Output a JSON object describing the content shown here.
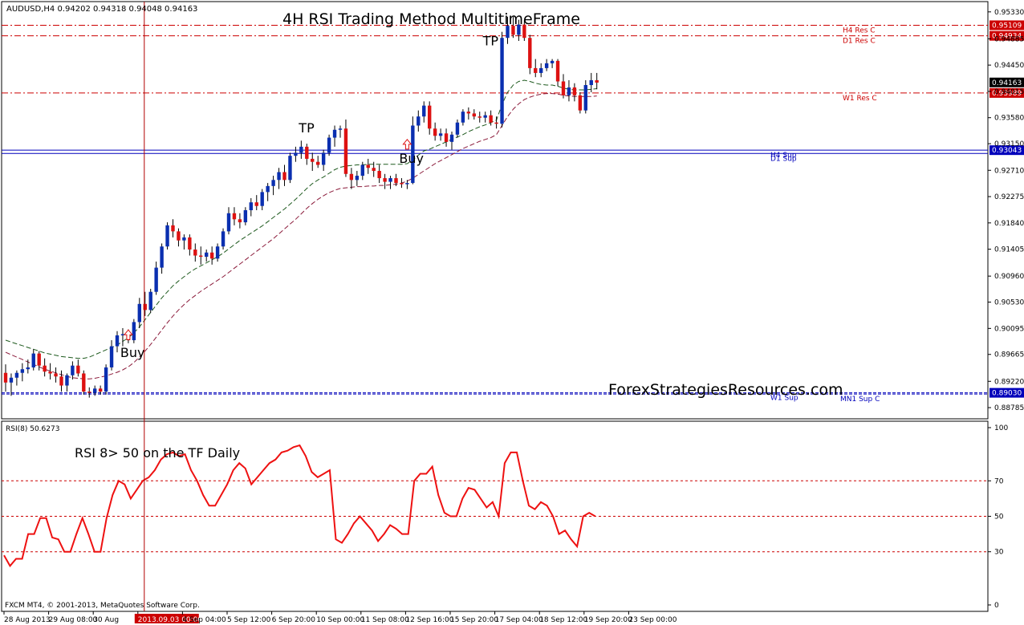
{
  "chart_data": [
    {
      "type": "candlestick",
      "symbol_info": "AUDUSD,H4  0.94202 0.94318 0.94048 0.94163",
      "title": "4H RSI Trading Method MultitimeFrame",
      "watermark": "ForexStrategiesResources.com",
      "ylim": [
        0.886,
        0.955
      ],
      "y_ticks": [
        "0.95330",
        "0.94885",
        "0.94450",
        "0.94015",
        "0.93580",
        "0.93150",
        "0.92710",
        "0.92275",
        "0.91840",
        "0.91405",
        "0.90960",
        "0.90530",
        "0.90095",
        "0.89665",
        "0.89220",
        "0.88785"
      ],
      "y_tick_values": [
        0.9533,
        0.94885,
        0.9445,
        0.94015,
        0.9358,
        0.9315,
        0.9271,
        0.92275,
        0.9184,
        0.91405,
        0.9096,
        0.9053,
        0.90095,
        0.89665,
        0.8922,
        0.88785
      ],
      "x_ticks": [
        "28 Aug 2013",
        "29 Aug 08:00",
        "30 Aug",
        "2013.09.03 00:00",
        "4 Sep 04:00",
        "5 Sep 12:00",
        "6 Sep 20:00",
        "10 Sep 00:00",
        "11 Sep 08:00",
        "12 Sep 16:00",
        "15 Sep 20:00",
        "17 Sep 04:00",
        "18 Sep 12:00",
        "19 Sep 20:00",
        "23 Sep 00:00"
      ],
      "x_tick_bars": [
        0,
        8,
        16,
        24,
        32,
        40,
        48,
        56,
        64,
        72,
        80,
        88,
        96,
        104,
        112
      ],
      "highlight_x_tick": "2013.09.03 00:00",
      "candles_ohlc": [
        [
          0.8936,
          0.895,
          0.8905,
          0.892
        ],
        [
          0.892,
          0.8935,
          0.8898,
          0.8928
        ],
        [
          0.8928,
          0.894,
          0.8915,
          0.8936
        ],
        [
          0.8936,
          0.8952,
          0.8922,
          0.8942
        ],
        [
          0.8942,
          0.8958,
          0.8935,
          0.8945
        ],
        [
          0.8945,
          0.8975,
          0.894,
          0.8968
        ],
        [
          0.8968,
          0.8972,
          0.894,
          0.8948
        ],
        [
          0.8948,
          0.896,
          0.893,
          0.8938
        ],
        [
          0.8938,
          0.8952,
          0.8925,
          0.8935
        ],
        [
          0.8935,
          0.8945,
          0.892,
          0.893
        ],
        [
          0.893,
          0.894,
          0.8905,
          0.8915
        ],
        [
          0.8915,
          0.8935,
          0.8905,
          0.8932
        ],
        [
          0.8932,
          0.8955,
          0.8925,
          0.8948
        ],
        [
          0.8948,
          0.8958,
          0.893,
          0.8935
        ],
        [
          0.8935,
          0.894,
          0.89,
          0.8905
        ],
        [
          0.8905,
          0.8912,
          0.8895,
          0.8903
        ],
        [
          0.8903,
          0.8915,
          0.8898,
          0.891
        ],
        [
          0.891,
          0.8915,
          0.89,
          0.8905
        ],
        [
          0.8905,
          0.895,
          0.89,
          0.8945
        ],
        [
          0.8945,
          0.899,
          0.894,
          0.898
        ],
        [
          0.898,
          0.9005,
          0.897,
          0.8998
        ],
        [
          0.8998,
          0.901,
          0.898,
          0.9
        ],
        [
          0.9,
          0.9008,
          0.8985,
          0.899
        ],
        [
          0.899,
          0.9025,
          0.8985,
          0.902
        ],
        [
          0.902,
          0.906,
          0.901,
          0.905
        ],
        [
          0.905,
          0.907,
          0.903,
          0.904
        ],
        [
          0.904,
          0.9075,
          0.9035,
          0.907
        ],
        [
          0.907,
          0.912,
          0.9065,
          0.911
        ],
        [
          0.911,
          0.915,
          0.91,
          0.9145
        ],
        [
          0.9145,
          0.9185,
          0.914,
          0.918
        ],
        [
          0.918,
          0.919,
          0.916,
          0.917
        ],
        [
          0.917,
          0.9175,
          0.9145,
          0.9155
        ],
        [
          0.9155,
          0.9165,
          0.914,
          0.916
        ],
        [
          0.916,
          0.9165,
          0.913,
          0.914
        ],
        [
          0.914,
          0.915,
          0.912,
          0.913
        ],
        [
          0.913,
          0.9145,
          0.9115,
          0.9128
        ],
        [
          0.9128,
          0.914,
          0.912,
          0.9135
        ],
        [
          0.9135,
          0.9145,
          0.9115,
          0.9125
        ],
        [
          0.9125,
          0.915,
          0.912,
          0.9145
        ],
        [
          0.9145,
          0.9175,
          0.914,
          0.917
        ],
        [
          0.917,
          0.921,
          0.9165,
          0.92
        ],
        [
          0.92,
          0.921,
          0.918,
          0.919
        ],
        [
          0.919,
          0.92,
          0.9175,
          0.9185
        ],
        [
          0.9185,
          0.921,
          0.918,
          0.9205
        ],
        [
          0.9205,
          0.9225,
          0.9195,
          0.9218
        ],
        [
          0.9218,
          0.923,
          0.9205,
          0.9212
        ],
        [
          0.9212,
          0.924,
          0.9205,
          0.9235
        ],
        [
          0.9235,
          0.925,
          0.922,
          0.9245
        ],
        [
          0.9245,
          0.9262,
          0.923,
          0.9255
        ],
        [
          0.9255,
          0.9275,
          0.924,
          0.9268
        ],
        [
          0.9268,
          0.928,
          0.9245,
          0.9255
        ],
        [
          0.9255,
          0.93,
          0.925,
          0.9295
        ],
        [
          0.9295,
          0.931,
          0.9285,
          0.93
        ],
        [
          0.93,
          0.932,
          0.929,
          0.931
        ],
        [
          0.931,
          0.9315,
          0.928,
          0.929
        ],
        [
          0.929,
          0.93,
          0.927,
          0.9285
        ],
        [
          0.9285,
          0.9295,
          0.9275,
          0.928
        ],
        [
          0.928,
          0.9305,
          0.927,
          0.93
        ],
        [
          0.93,
          0.933,
          0.9295,
          0.9325
        ],
        [
          0.9325,
          0.9345,
          0.931,
          0.9338
        ],
        [
          0.9338,
          0.9345,
          0.9325,
          0.934
        ],
        [
          0.934,
          0.9355,
          0.926,
          0.9265
        ],
        [
          0.9265,
          0.9275,
          0.924,
          0.9255
        ],
        [
          0.9255,
          0.927,
          0.9245,
          0.9262
        ],
        [
          0.9262,
          0.9285,
          0.9255,
          0.928
        ],
        [
          0.928,
          0.929,
          0.9265,
          0.9275
        ],
        [
          0.9275,
          0.9285,
          0.926,
          0.927
        ],
        [
          0.927,
          0.928,
          0.925,
          0.9258
        ],
        [
          0.9258,
          0.9265,
          0.924,
          0.9252
        ],
        [
          0.9252,
          0.9262,
          0.924,
          0.9258
        ],
        [
          0.9258,
          0.9265,
          0.9245,
          0.925
        ],
        [
          0.925,
          0.9258,
          0.9242,
          0.9248
        ],
        [
          0.9248,
          0.9255,
          0.924,
          0.925
        ],
        [
          0.925,
          0.936,
          0.9248,
          0.9345
        ],
        [
          0.9345,
          0.937,
          0.9335,
          0.936
        ],
        [
          0.936,
          0.9385,
          0.935,
          0.9378
        ],
        [
          0.9378,
          0.9385,
          0.933,
          0.934
        ],
        [
          0.934,
          0.935,
          0.932,
          0.9328
        ],
        [
          0.9328,
          0.934,
          0.932,
          0.9332
        ],
        [
          0.9332,
          0.934,
          0.931,
          0.9318
        ],
        [
          0.9318,
          0.9335,
          0.9305,
          0.933
        ],
        [
          0.933,
          0.9355,
          0.9325,
          0.935
        ],
        [
          0.935,
          0.9372,
          0.9345,
          0.9368
        ],
        [
          0.9368,
          0.9375,
          0.9355,
          0.9365
        ],
        [
          0.9365,
          0.9372,
          0.9355,
          0.936
        ],
        [
          0.936,
          0.9368,
          0.935,
          0.9358
        ],
        [
          0.9358,
          0.9368,
          0.935,
          0.9362
        ],
        [
          0.9362,
          0.937,
          0.9345,
          0.935
        ],
        [
          0.935,
          0.936,
          0.934,
          0.9348
        ],
        [
          0.9348,
          0.95,
          0.9342,
          0.949
        ],
        [
          0.949,
          0.9525,
          0.948,
          0.951
        ],
        [
          0.951,
          0.9525,
          0.949,
          0.9495
        ],
        [
          0.9495,
          0.952,
          0.9485,
          0.9512
        ],
        [
          0.9512,
          0.952,
          0.9485,
          0.949
        ],
        [
          0.949,
          0.9495,
          0.943,
          0.944
        ],
        [
          0.944,
          0.9455,
          0.9425,
          0.9432
        ],
        [
          0.9432,
          0.9448,
          0.9425,
          0.944
        ],
        [
          0.944,
          0.9455,
          0.9435,
          0.9448
        ],
        [
          0.9448,
          0.9455,
          0.944,
          0.9452
        ],
        [
          0.9452,
          0.9455,
          0.941,
          0.9418
        ],
        [
          0.9418,
          0.943,
          0.939,
          0.9395
        ],
        [
          0.9395,
          0.942,
          0.9385,
          0.9408
        ],
        [
          0.9408,
          0.9415,
          0.9385,
          0.9395
        ],
        [
          0.9395,
          0.94,
          0.9365,
          0.937
        ],
        [
          0.937,
          0.942,
          0.9365,
          0.9412
        ],
        [
          0.9412,
          0.9432,
          0.94,
          0.942
        ],
        [
          0.942,
          0.9432,
          0.9405,
          0.9416
        ]
      ],
      "ma_upper": [
        0.899,
        0.8987,
        0.8984,
        0.8981,
        0.8978,
        0.8975,
        0.8972,
        0.8969,
        0.8967,
        0.8965,
        0.8963,
        0.8962,
        0.8961,
        0.896,
        0.896,
        0.8962,
        0.8966,
        0.897,
        0.8974,
        0.8978,
        0.8982,
        0.8988,
        0.8994,
        0.9002,
        0.9012,
        0.9024,
        0.9036,
        0.9048,
        0.906,
        0.907,
        0.908,
        0.9088,
        0.9095,
        0.9102,
        0.9108,
        0.9113,
        0.9118,
        0.9123,
        0.9128,
        0.9134,
        0.9141,
        0.9148,
        0.9155,
        0.9161,
        0.9167,
        0.9173,
        0.9179,
        0.9186,
        0.9193,
        0.92,
        0.9207,
        0.9215,
        0.9223,
        0.9232,
        0.9241,
        0.9249,
        0.9255,
        0.926,
        0.9266,
        0.9272,
        0.9276,
        0.9278,
        0.9279,
        0.928,
        0.928,
        0.9281,
        0.9281,
        0.9281,
        0.9281,
        0.9281,
        0.9281,
        0.9281,
        0.9282,
        0.9288,
        0.9296,
        0.9303,
        0.9306,
        0.931,
        0.9314,
        0.9318,
        0.9322,
        0.9326,
        0.933,
        0.9335,
        0.9339,
        0.9343,
        0.9346,
        0.935,
        0.9354,
        0.938,
        0.94,
        0.9412,
        0.9418,
        0.942,
        0.9418,
        0.9415,
        0.9413,
        0.9412,
        0.9412,
        0.941,
        0.9407,
        0.9405,
        0.9404,
        0.9404,
        0.9404,
        0.9405,
        0.9406
      ],
      "ma_lower": [
        0.897,
        0.8966,
        0.8962,
        0.8958,
        0.8954,
        0.895,
        0.8946,
        0.8942,
        0.8939,
        0.8936,
        0.8933,
        0.893,
        0.8928,
        0.8927,
        0.8926,
        0.8926,
        0.8927,
        0.8929,
        0.8931,
        0.8934,
        0.8937,
        0.8941,
        0.8946,
        0.8953,
        0.8962,
        0.8972,
        0.8983,
        0.8995,
        0.9007,
        0.9019,
        0.903,
        0.904,
        0.9049,
        0.9057,
        0.9064,
        0.9071,
        0.9077,
        0.9083,
        0.9089,
        0.9095,
        0.9102,
        0.9109,
        0.9116,
        0.9123,
        0.913,
        0.9137,
        0.9144,
        0.9151,
        0.9158,
        0.9166,
        0.9174,
        0.9182,
        0.919,
        0.9199,
        0.9208,
        0.9216,
        0.9223,
        0.9229,
        0.9234,
        0.9238,
        0.9241,
        0.9242,
        0.9243,
        0.9244,
        0.9244,
        0.9245,
        0.9245,
        0.9246,
        0.9246,
        0.9247,
        0.9248,
        0.925,
        0.9253,
        0.9258,
        0.9264,
        0.927,
        0.9276,
        0.9282,
        0.9287,
        0.9292,
        0.9297,
        0.9302,
        0.9307,
        0.9311,
        0.9315,
        0.9319,
        0.9322,
        0.9325,
        0.933,
        0.9345,
        0.936,
        0.9372,
        0.9381,
        0.9388,
        0.9392,
        0.9395,
        0.9397,
        0.9398,
        0.9398,
        0.9397,
        0.9395,
        0.9394,
        0.9393,
        0.9393,
        0.9393,
        0.9393,
        0.9394
      ],
      "levels": [
        {
          "label": "H4 Res C",
          "value": 0.95109,
          "tag": "0.95109",
          "color": "#cc0000",
          "style": "dashdot"
        },
        {
          "label": "D1 Res C",
          "value": 0.94934,
          "tag": "0.94934",
          "color": "#cc0000",
          "style": "dashdot"
        },
        {
          "label": "W1 Res C",
          "value": 0.93989,
          "tag": "0.93989",
          "color": "#cc0000",
          "style": "dashdot"
        },
        {
          "label": "H4 Sup",
          "value": 0.93043,
          "tag": "0.93043",
          "color": "#0000bb",
          "style": "solid"
        },
        {
          "label": "D1 Sup",
          "value": 0.92988,
          "tag": "",
          "color": "#0000bb",
          "style": "solid"
        },
        {
          "label": "W1 Sup",
          "value": 0.8903,
          "tag": "0.89030",
          "color": "#0000bb",
          "style": "dashed"
        },
        {
          "label": "MN1 Sup C",
          "value": 0.8901,
          "tag": "",
          "color": "#0000bb",
          "style": "dashed"
        }
      ],
      "current_price": {
        "value": 0.94163,
        "tag": "0.94163"
      },
      "annotations": [
        {
          "text": "Buy",
          "bar": 22,
          "price": 0.8962
        },
        {
          "text": "Buy",
          "bar": 72,
          "price": 0.9283
        },
        {
          "text": "TP",
          "bar": 54,
          "price": 0.9334
        },
        {
          "text": "TP",
          "bar": 87,
          "price": 0.9478
        }
      ],
      "buy_arrows": [
        {
          "bar": 22,
          "price": 0.9007
        },
        {
          "bar": 72,
          "price": 0.9322
        }
      ],
      "marker_bar": 24
    },
    {
      "type": "line",
      "label": "RSI(8) 50.6273",
      "annotation": "RSI 8> 50 on the TF Daily",
      "ylim": [
        0,
        100
      ],
      "y_ticks": [
        100,
        70,
        50,
        30,
        0
      ],
      "levels": [
        70,
        50,
        30
      ],
      "values": [
        28,
        22,
        26,
        26,
        40,
        40,
        49,
        49,
        38,
        37,
        30,
        30,
        40,
        49,
        40,
        30,
        30,
        49,
        62,
        70,
        68,
        60,
        65,
        70,
        72,
        76,
        82,
        85,
        86,
        84,
        85,
        76,
        70,
        62,
        56,
        56,
        62,
        68,
        76,
        80,
        77,
        68,
        72,
        76,
        80,
        82,
        86,
        87,
        89,
        90,
        84,
        75,
        72,
        74,
        76,
        37,
        35,
        40,
        46,
        50,
        46,
        42,
        36,
        40,
        45,
        43,
        40,
        40,
        70,
        74,
        74,
        78,
        62,
        52,
        50,
        50,
        60,
        66,
        65,
        60,
        55,
        58,
        50,
        80,
        86,
        86,
        70,
        56,
        54,
        58,
        56,
        50,
        40,
        42,
        37,
        33,
        50,
        52,
        50
      ],
      "x_align_first_bar": 0
    }
  ],
  "footer": "FXCM MT4, © 2001-2013, MetaQuotes Software Corp."
}
